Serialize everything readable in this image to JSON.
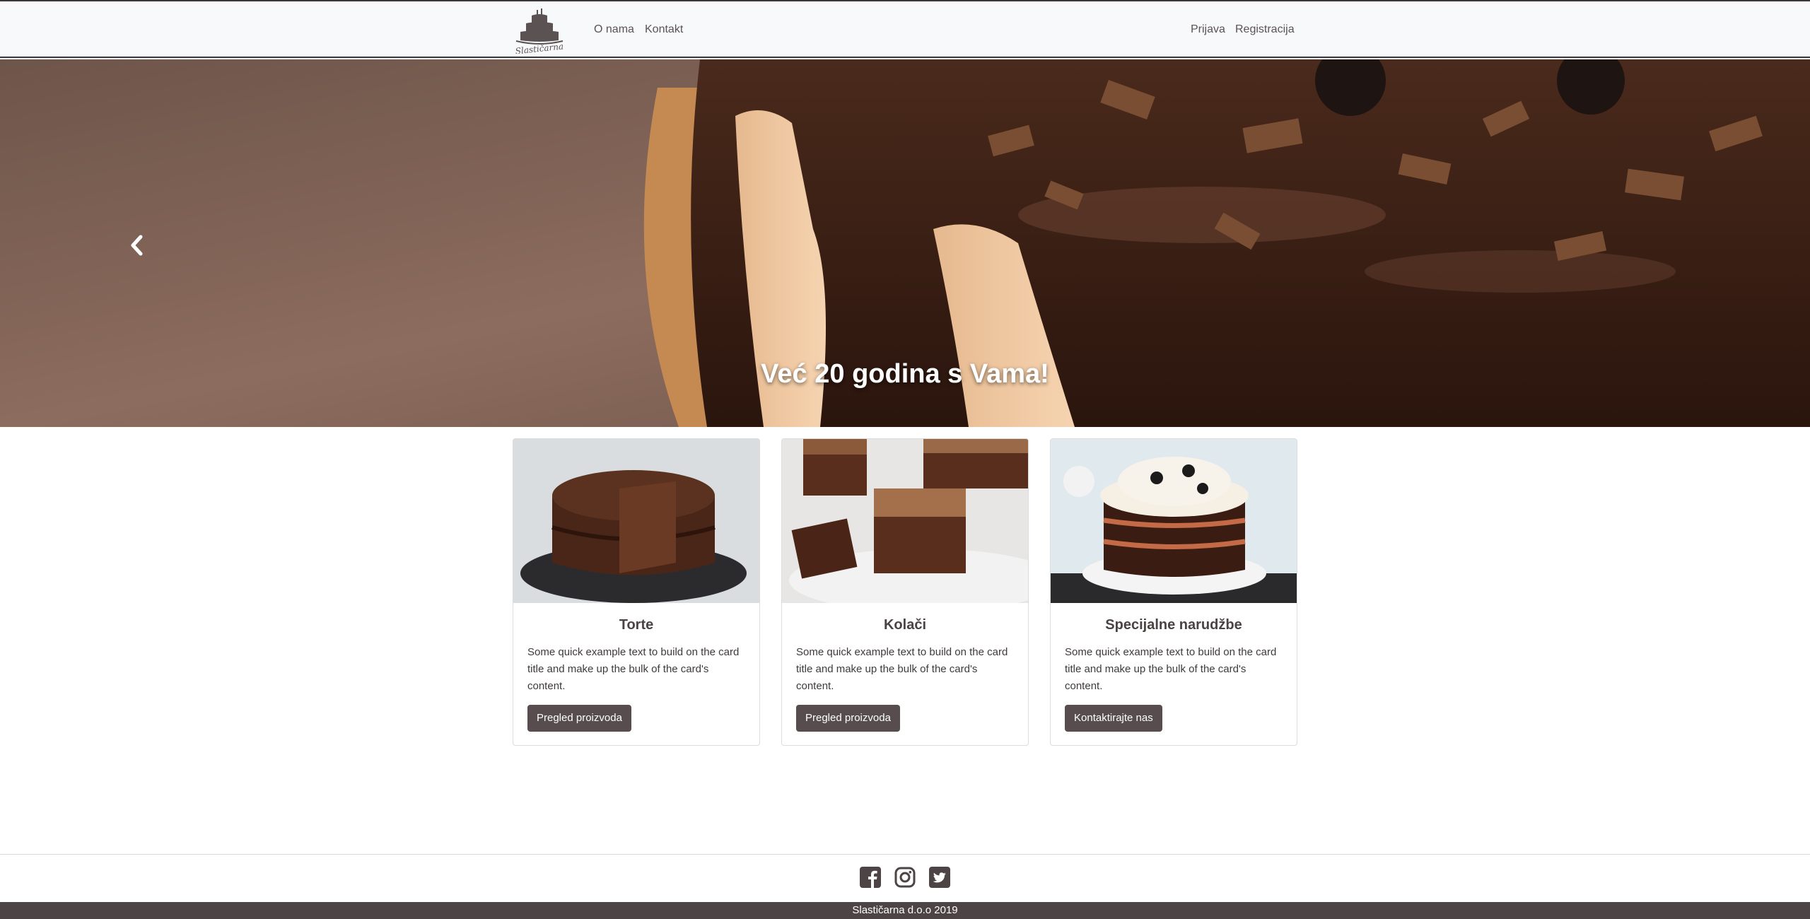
{
  "navbar": {
    "logo_text": "Slastičarna",
    "links_left": [
      "O nama",
      "Kontakt"
    ],
    "links_right": [
      "Prijava",
      "Registracija"
    ]
  },
  "hero": {
    "caption": "Već 20 godina s Vama!",
    "prev_icon": "chevron-left-icon"
  },
  "cards": [
    {
      "title": "Torte",
      "text": "Some quick example text to build on the card title and make up the bulk of the card's content.",
      "button": "Pregled proizvoda"
    },
    {
      "title": "Kolači",
      "text": "Some quick example text to build on the card title and make up the bulk of the card's content.",
      "button": "Pregled proizvoda"
    },
    {
      "title": "Specijalne narudžbe",
      "text": "Some quick example text to build on the card title and make up the bulk of the card's content.",
      "button": "Kontaktirajte nas"
    }
  ],
  "footer": {
    "social_icons": [
      "facebook-icon",
      "instagram-icon",
      "twitter-icon"
    ],
    "copyright": "Slastičarna d.o.o 2019"
  },
  "colors": {
    "brand": "#574d4f",
    "footer_bar": "#4d4446",
    "navbar_bg": "#f8f9fa"
  }
}
